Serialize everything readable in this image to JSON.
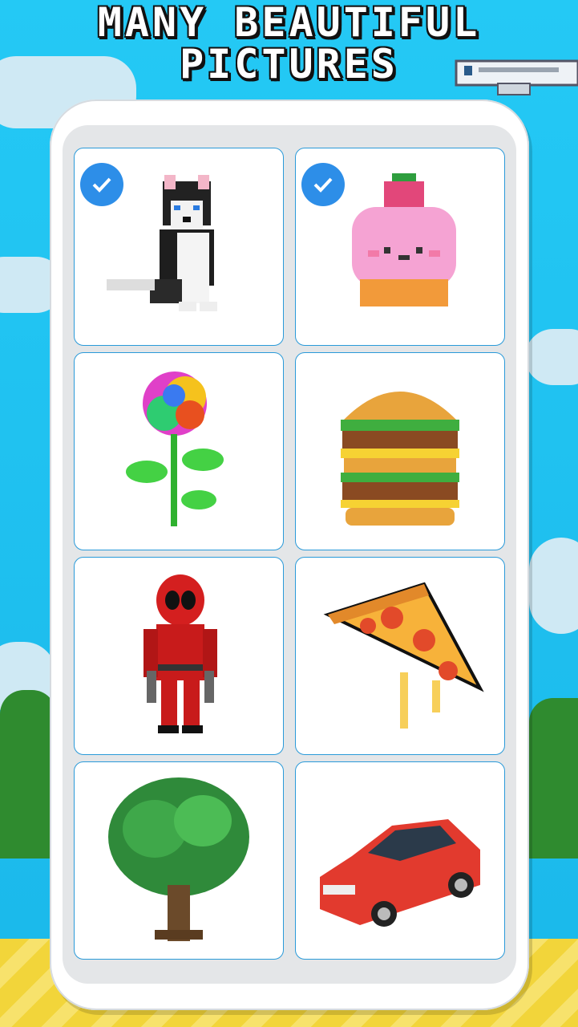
{
  "banner": {
    "line1": "MANY BEAUTIFUL",
    "line2": "PICTURES"
  },
  "gallery": {
    "items": [
      {
        "name": "husky",
        "completed": true
      },
      {
        "name": "cupcake",
        "completed": true
      },
      {
        "name": "rainbow-rose",
        "completed": false
      },
      {
        "name": "burger",
        "completed": false
      },
      {
        "name": "deadpool",
        "completed": false
      },
      {
        "name": "pizza-slice",
        "completed": false
      },
      {
        "name": "tree",
        "completed": false
      },
      {
        "name": "red-car",
        "completed": false
      }
    ]
  },
  "colors": {
    "sky": "#21c6f2",
    "card_border": "#2a9ad9",
    "check_badge": "#2d8ee8",
    "ground": "#f2d53a"
  }
}
